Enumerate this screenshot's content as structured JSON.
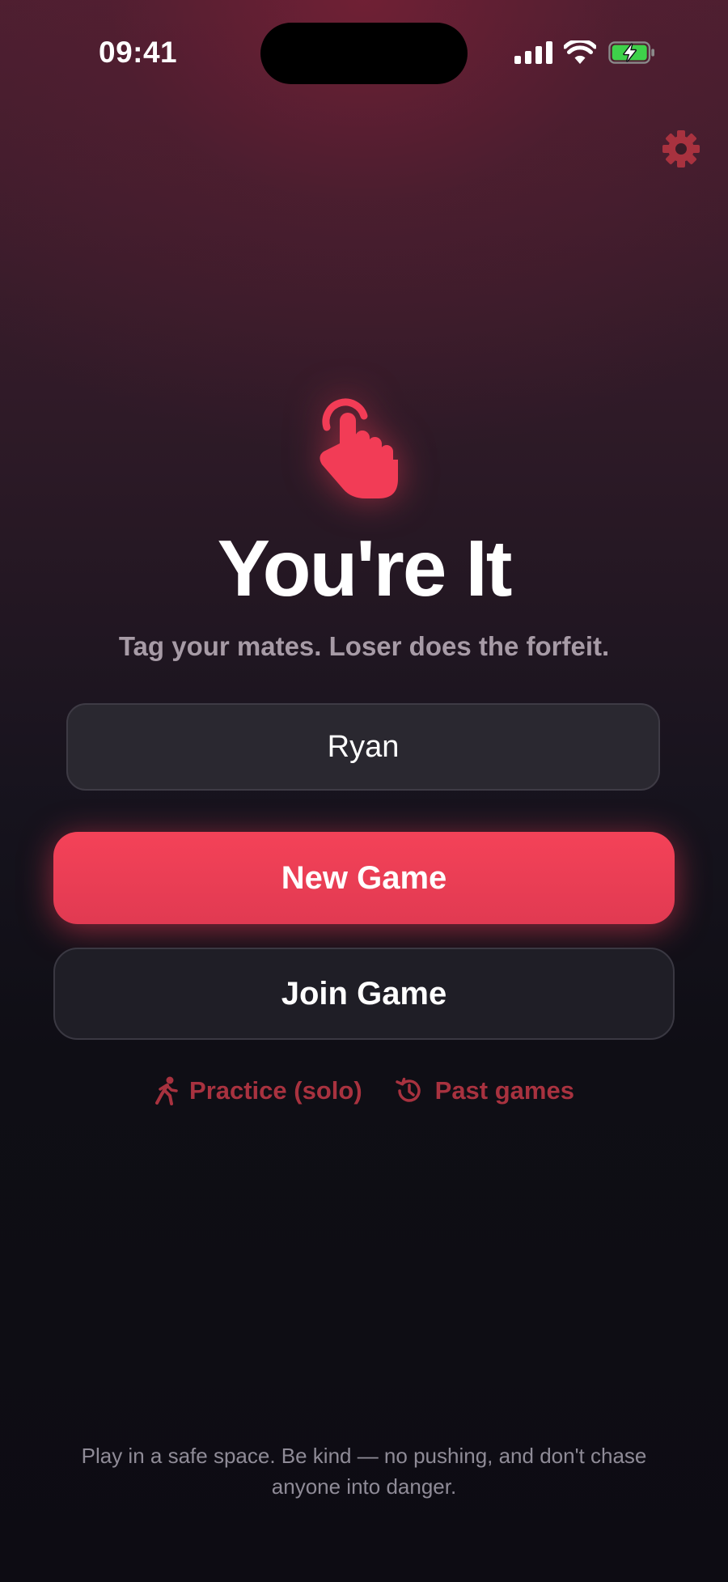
{
  "status_bar": {
    "time": "09:41"
  },
  "hero": {
    "title": "You're It",
    "tagline": "Tag your mates. Loser does the forfeit."
  },
  "name_input": {
    "value": "Ryan"
  },
  "buttons": {
    "new_game": "New Game",
    "join_game": "Join Game"
  },
  "links": {
    "practice": "Practice (solo)",
    "past_games": "Past games"
  },
  "footer": {
    "safety_note": "Play in a safe space. Be kind — no pushing, and don't chase anyone into danger."
  },
  "icons": {
    "settings": "gear-icon",
    "hero": "pointing-hand-icon",
    "practice": "running-person-icon",
    "past_games": "history-icon"
  },
  "colors": {
    "accent": "#f23c56",
    "link": "#a8323f",
    "battery_fill": "#3ed14a"
  }
}
